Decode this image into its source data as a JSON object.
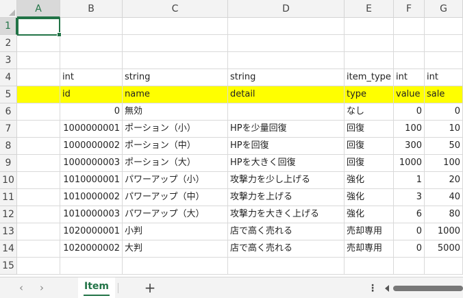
{
  "sheet": {
    "columns": [
      "A",
      "B",
      "C",
      "D",
      "E",
      "F",
      "G"
    ],
    "rows": [
      {
        "num": "1",
        "cells": [
          "",
          "",
          "",
          "",
          "",
          "",
          ""
        ]
      },
      {
        "num": "2",
        "cells": [
          "",
          "",
          "",
          "",
          "",
          "",
          ""
        ]
      },
      {
        "num": "3",
        "cells": [
          "",
          "",
          "",
          "",
          "",
          "",
          ""
        ]
      },
      {
        "num": "4",
        "cells": [
          "",
          "int",
          "string",
          "string",
          "item_type",
          "int",
          "int"
        ]
      },
      {
        "num": "5",
        "cells": [
          "",
          "id",
          "name",
          "detail",
          "type",
          "value",
          "sale"
        ]
      },
      {
        "num": "6",
        "cells": [
          "",
          "0",
          "無効",
          "",
          "なし",
          "0",
          "0"
        ]
      },
      {
        "num": "7",
        "cells": [
          "",
          "1000000001",
          "ポーション（小）",
          "HPを少量回復",
          "回復",
          "100",
          "10"
        ]
      },
      {
        "num": "8",
        "cells": [
          "",
          "1000000002",
          "ポーション（中）",
          "HPを回復",
          "回復",
          "300",
          "50"
        ]
      },
      {
        "num": "9",
        "cells": [
          "",
          "1000000003",
          "ポーション（大）",
          "HPを大きく回復",
          "回復",
          "1000",
          "100"
        ]
      },
      {
        "num": "10",
        "cells": [
          "",
          "1010000001",
          "パワーアップ（小）",
          "攻撃力を少し上げる",
          "強化",
          "1",
          "20"
        ]
      },
      {
        "num": "11",
        "cells": [
          "",
          "1010000002",
          "パワーアップ（中）",
          "攻撃力を上げる",
          "強化",
          "3",
          "40"
        ]
      },
      {
        "num": "12",
        "cells": [
          "",
          "1010000003",
          "パワーアップ（大）",
          "攻撃力を大きく上げる",
          "強化",
          "6",
          "80"
        ]
      },
      {
        "num": "13",
        "cells": [
          "",
          "1020000001",
          "小判",
          "店で高く売れる",
          "売却専用",
          "0",
          "1000"
        ]
      },
      {
        "num": "14",
        "cells": [
          "",
          "1020000002",
          "大判",
          "店で高く売れる",
          "売却専用",
          "0",
          "5000"
        ]
      },
      {
        "num": "15",
        "cells": [
          "",
          "",
          "",
          "",
          "",
          "",
          ""
        ]
      }
    ],
    "selected_cell": "A1",
    "highlight_row": "5",
    "highlight_color": "#ffff00",
    "accent_color": "#217346"
  },
  "tabbar": {
    "prev_icon": "chevron-left-icon",
    "next_icon": "chevron-right-icon",
    "active_tab": "Item",
    "add_label": "+",
    "more_label": "⋮"
  }
}
